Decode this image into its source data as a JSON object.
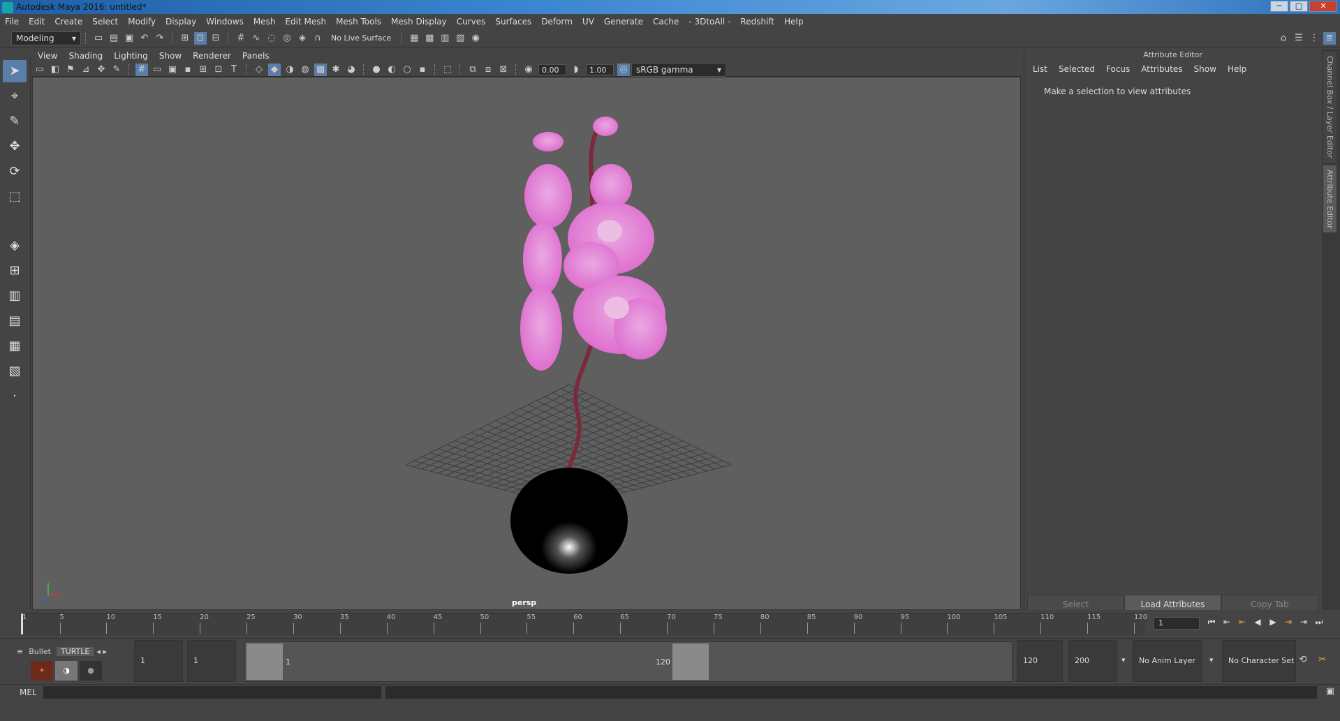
{
  "window": {
    "title": "Autodesk Maya 2016: untitled*",
    "minimize": "─",
    "maximize": "□",
    "close": "✕"
  },
  "menu": [
    "File",
    "Edit",
    "Create",
    "Select",
    "Modify",
    "Display",
    "Windows",
    "Mesh",
    "Edit Mesh",
    "Mesh Tools",
    "Mesh Display",
    "Curves",
    "Surfaces",
    "Deform",
    "UV",
    "Generate",
    "Cache",
    "- 3DtoAll -",
    "Redshift",
    "Help"
  ],
  "shelf": {
    "mode": "Modeling",
    "live_surface": "No Live Surface"
  },
  "viewport": {
    "menu": [
      "View",
      "Shading",
      "Lighting",
      "Show",
      "Renderer",
      "Panels"
    ],
    "exposure": "0.00",
    "gamma": "1.00",
    "colorspace": "sRGB gamma",
    "camera": "persp",
    "colors": {
      "petal": "#e86ad6",
      "petal_light": "#f6b0ee",
      "stem": "#7a2a3c",
      "vase": "#000000",
      "grid": "#3d3d3d"
    }
  },
  "attribute_editor": {
    "header": "Attribute Editor",
    "tabs": [
      "List",
      "Selected",
      "Focus",
      "Attributes",
      "Show",
      "Help"
    ],
    "message": "Make a selection to view attributes",
    "buttons": {
      "select": "Select",
      "load": "Load Attributes",
      "copy": "Copy Tab"
    }
  },
  "side_tabs": {
    "channel": "Channel Box / Layer Editor",
    "attr": "Attribute Editor"
  },
  "timeline": {
    "ticks": [
      "1",
      "5",
      "10",
      "15",
      "20",
      "25",
      "30",
      "35",
      "40",
      "45",
      "50",
      "55",
      "60",
      "65",
      "70",
      "75",
      "80",
      "85",
      "90",
      "95",
      "100",
      "105",
      "110",
      "115",
      "120"
    ],
    "current_frame": "1"
  },
  "range": {
    "shelf_tabs": [
      "Bullet",
      "TURTLE"
    ],
    "start": "1",
    "playback_start": "1",
    "range_start_label": "1",
    "range_end_label": "120",
    "playback_end": "120",
    "end": "200",
    "anim_layer": "No Anim Layer",
    "character_set": "No Character Set"
  },
  "command": {
    "label": "MEL"
  }
}
